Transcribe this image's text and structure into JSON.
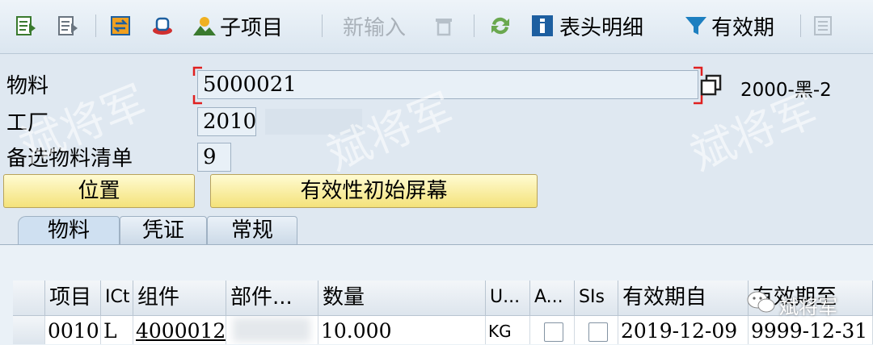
{
  "toolbar": {
    "sub_item": "子项目",
    "new_entry": "新输入",
    "header_detail": "表头明细",
    "validity": "有效期"
  },
  "form": {
    "material_label": "物料",
    "material_value": "5000021",
    "material_desc": "2000-黑-2",
    "plant_label": "工厂",
    "plant_value": "2010",
    "alt_bom_label": "备选物料清单",
    "alt_bom_value": "9"
  },
  "buttons": {
    "position": "位置",
    "validity_init": "有效性初始屏幕"
  },
  "tabs": [
    "物料",
    "凭证",
    "常规"
  ],
  "table": {
    "headers": [
      "项目",
      "ICt",
      "组件",
      "部件...",
      "数量",
      "U...",
      "A...",
      "SIs",
      "有效期自",
      "有效期至"
    ],
    "rows": [
      {
        "item": "0010",
        "ict": "L",
        "component": "4000012",
        "desc": "",
        "qty": "10.000",
        "unit": "KG",
        "from": "2019-12-09",
        "to": "9999-12-31"
      }
    ]
  },
  "watermark": {
    "text": "斌将军",
    "badge": "斌将军"
  }
}
